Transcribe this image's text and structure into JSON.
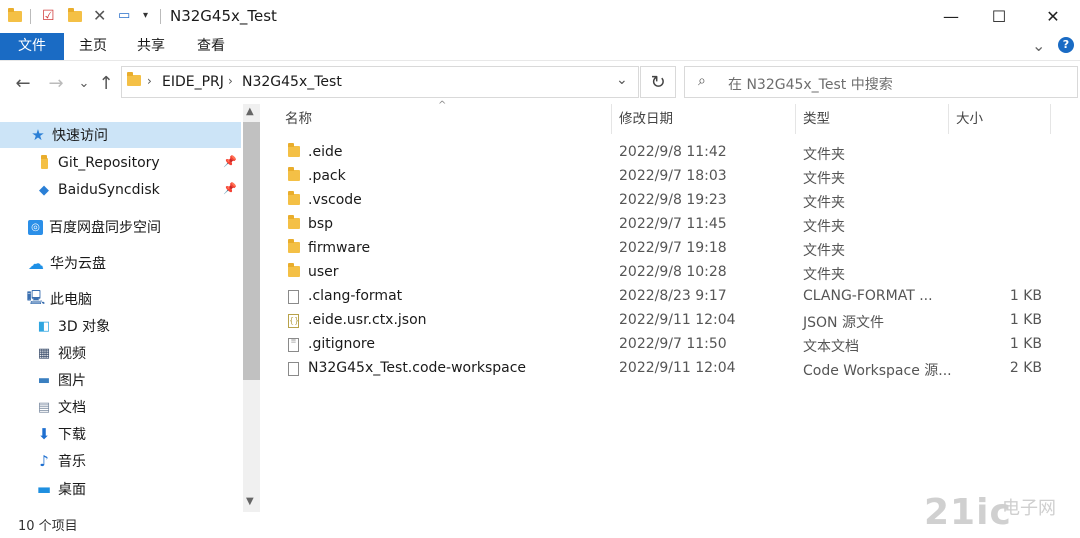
{
  "window": {
    "title": "N32G45x_Test",
    "minimize_glyph": "—",
    "maximize_glyph": "☐",
    "close_glyph": "✕"
  },
  "ribbon": {
    "tabs": [
      "文件",
      "主页",
      "共享",
      "查看"
    ],
    "expand_glyph": "⌄",
    "help_glyph": "?"
  },
  "address": {
    "back_glyph": "←",
    "forward_glyph": "→",
    "recent_glyph": "⌄",
    "up_glyph": "↑",
    "breadcrumb": [
      "EIDE_PRJ",
      "N32G45x_Test"
    ],
    "dropdown_glyph": "⌄",
    "refresh_glyph": "↻",
    "search_placeholder": "在 N32G45x_Test 中搜索"
  },
  "nav": {
    "quick_access": "快速访问",
    "pinned": [
      "Git_Repository",
      "BaiduSyncdisk"
    ],
    "baidu_netdisk": "百度网盘同步空间",
    "huawei_cloud": "华为云盘",
    "this_pc": "此电脑",
    "pc_items": [
      "3D 对象",
      "视频",
      "图片",
      "文档",
      "下载",
      "音乐",
      "桌面"
    ]
  },
  "columns": {
    "name": "名称",
    "date": "修改日期",
    "type": "类型",
    "size": "大小"
  },
  "files": [
    {
      "name": ".eide",
      "date": "2022/9/8 11:42",
      "type": "文件夹",
      "size": "",
      "icon": "folder"
    },
    {
      "name": ".pack",
      "date": "2022/9/7 18:03",
      "type": "文件夹",
      "size": "",
      "icon": "folder"
    },
    {
      "name": ".vscode",
      "date": "2022/9/8 19:23",
      "type": "文件夹",
      "size": "",
      "icon": "folder"
    },
    {
      "name": "bsp",
      "date": "2022/9/7 11:45",
      "type": "文件夹",
      "size": "",
      "icon": "folder"
    },
    {
      "name": "firmware",
      "date": "2022/9/7 19:18",
      "type": "文件夹",
      "size": "",
      "icon": "folder"
    },
    {
      "name": "user",
      "date": "2022/9/8 10:28",
      "type": "文件夹",
      "size": "",
      "icon": "folder"
    },
    {
      "name": ".clang-format",
      "date": "2022/8/23 9:17",
      "type": "CLANG-FORMAT ...",
      "size": "1 KB",
      "icon": "doc"
    },
    {
      "name": ".eide.usr.ctx.json",
      "date": "2022/9/11 12:04",
      "type": "JSON 源文件",
      "size": "1 KB",
      "icon": "json"
    },
    {
      "name": ".gitignore",
      "date": "2022/9/7 11:50",
      "type": "文本文档",
      "size": "1 KB",
      "icon": "text"
    },
    {
      "name": "N32G45x_Test.code-workspace",
      "date": "2022/9/11 12:04",
      "type": "Code Workspace 源...",
      "size": "2 KB",
      "icon": "doc"
    }
  ],
  "status": {
    "count": "10 个项目"
  },
  "watermark": {
    "main": "21ic",
    "sub": "电子网"
  },
  "colors": {
    "accent": "#1a6bc4",
    "folder": "#f4c046",
    "selected_nav": "#cce4f7"
  }
}
